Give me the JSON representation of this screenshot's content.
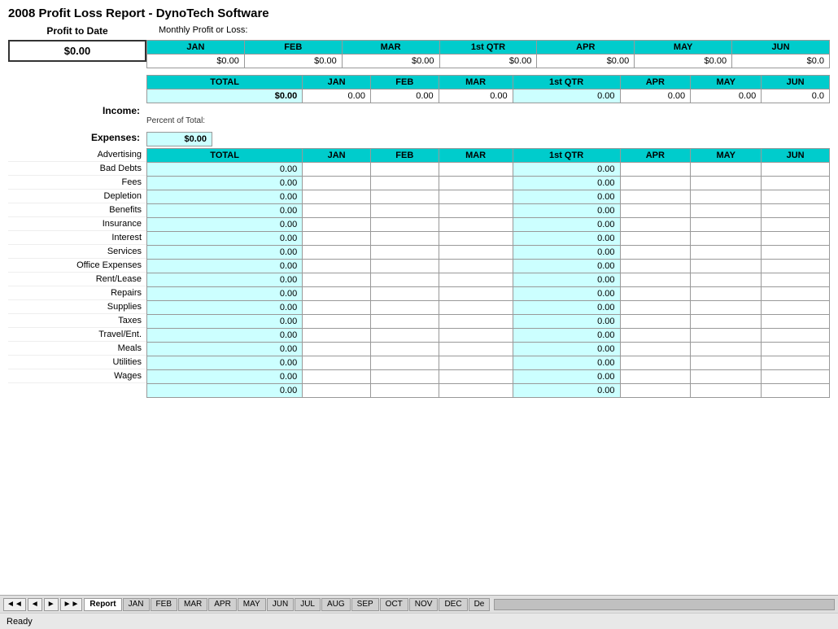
{
  "title": "2008 Profit Loss Report - DynoTech Software",
  "profit_section": {
    "profit_to_date_label": "Profit to Date",
    "monthly_profit_label": "Monthly Profit or Loss:",
    "profit_value": "$0.00",
    "columns": [
      "JAN",
      "FEB",
      "MAR",
      "1st QTR",
      "APR",
      "MAY",
      "JUN"
    ],
    "values": [
      "$0.00",
      "$0.00",
      "$0.00",
      "$0.00",
      "$0.00",
      "$0.00",
      "$0.0"
    ]
  },
  "income_section": {
    "label": "Income:",
    "total_label": "TOTAL",
    "columns": [
      "JAN",
      "FEB",
      "MAR",
      "1st QTR",
      "APR",
      "MAY",
      "JUN"
    ],
    "total_value": "$0.00",
    "row_values": [
      "0.00",
      "0.00",
      "0.00",
      "0.00",
      "0.00",
      "0.00",
      "0.0"
    ],
    "percent_note": "Percent of Total:"
  },
  "expenses_section": {
    "label": "Expenses:",
    "total_value": "$0.00",
    "total_label": "TOTAL",
    "columns": [
      "JAN",
      "FEB",
      "MAR",
      "1st QTR",
      "APR",
      "MAY",
      "JUN"
    ],
    "rows": [
      {
        "label": "Advertising",
        "total": "0.00",
        "qtr": "0.00",
        "others": [
          "",
          "",
          "",
          "",
          "",
          ""
        ]
      },
      {
        "label": "Bad Debts",
        "total": "0.00",
        "qtr": "0.00",
        "others": [
          "",
          "",
          "",
          "",
          "",
          ""
        ]
      },
      {
        "label": "Fees",
        "total": "0.00",
        "qtr": "0.00",
        "others": [
          "",
          "",
          "",
          "",
          "",
          ""
        ]
      },
      {
        "label": "Depletion",
        "total": "0.00",
        "qtr": "0.00",
        "others": [
          "",
          "",
          "",
          "",
          "",
          ""
        ]
      },
      {
        "label": "Benefits",
        "total": "0.00",
        "qtr": "0.00",
        "others": [
          "",
          "",
          "",
          "",
          "",
          ""
        ]
      },
      {
        "label": "Insurance",
        "total": "0.00",
        "qtr": "0.00",
        "others": [
          "",
          "",
          "",
          "",
          "",
          ""
        ]
      },
      {
        "label": "Interest",
        "total": "0.00",
        "qtr": "0.00",
        "others": [
          "",
          "",
          "",
          "",
          "",
          ""
        ]
      },
      {
        "label": "Services",
        "total": "0.00",
        "qtr": "0.00",
        "others": [
          "",
          "",
          "",
          "",
          "",
          ""
        ]
      },
      {
        "label": "Office Expenses",
        "total": "0.00",
        "qtr": "0.00",
        "others": [
          "",
          "",
          "",
          "",
          "",
          ""
        ]
      },
      {
        "label": "Rent/Lease",
        "total": "0.00",
        "qtr": "0.00",
        "others": [
          "",
          "",
          "",
          "",
          "",
          ""
        ]
      },
      {
        "label": "Repairs",
        "total": "0.00",
        "qtr": "0.00",
        "others": [
          "",
          "",
          "",
          "",
          "",
          ""
        ]
      },
      {
        "label": "Supplies",
        "total": "0.00",
        "qtr": "0.00",
        "others": [
          "",
          "",
          "",
          "",
          "",
          ""
        ]
      },
      {
        "label": "Taxes",
        "total": "0.00",
        "qtr": "0.00",
        "others": [
          "",
          "",
          "",
          "",
          "",
          ""
        ]
      },
      {
        "label": "Travel/Ent.",
        "total": "0.00",
        "qtr": "0.00",
        "others": [
          "",
          "",
          "",
          "",
          "",
          ""
        ]
      },
      {
        "label": "Meals",
        "total": "0.00",
        "qtr": "0.00",
        "others": [
          "",
          "",
          "",
          "",
          "",
          ""
        ]
      },
      {
        "label": "Utilities",
        "total": "0.00",
        "qtr": "0.00",
        "others": [
          "",
          "",
          "",
          "",
          "",
          ""
        ]
      },
      {
        "label": "Wages",
        "total": "0.00",
        "qtr": "0.00",
        "others": [
          "",
          "",
          "",
          "",
          "",
          ""
        ]
      }
    ]
  },
  "tabs": [
    "Report",
    "JAN",
    "FEB",
    "MAR",
    "APR",
    "MAY",
    "JUN",
    "JUL",
    "AUG",
    "SEP",
    "OCT",
    "NOV",
    "DEC",
    "De"
  ],
  "nav_buttons": [
    "◄◄",
    "◄",
    "►",
    "►►"
  ],
  "status": "Ready"
}
